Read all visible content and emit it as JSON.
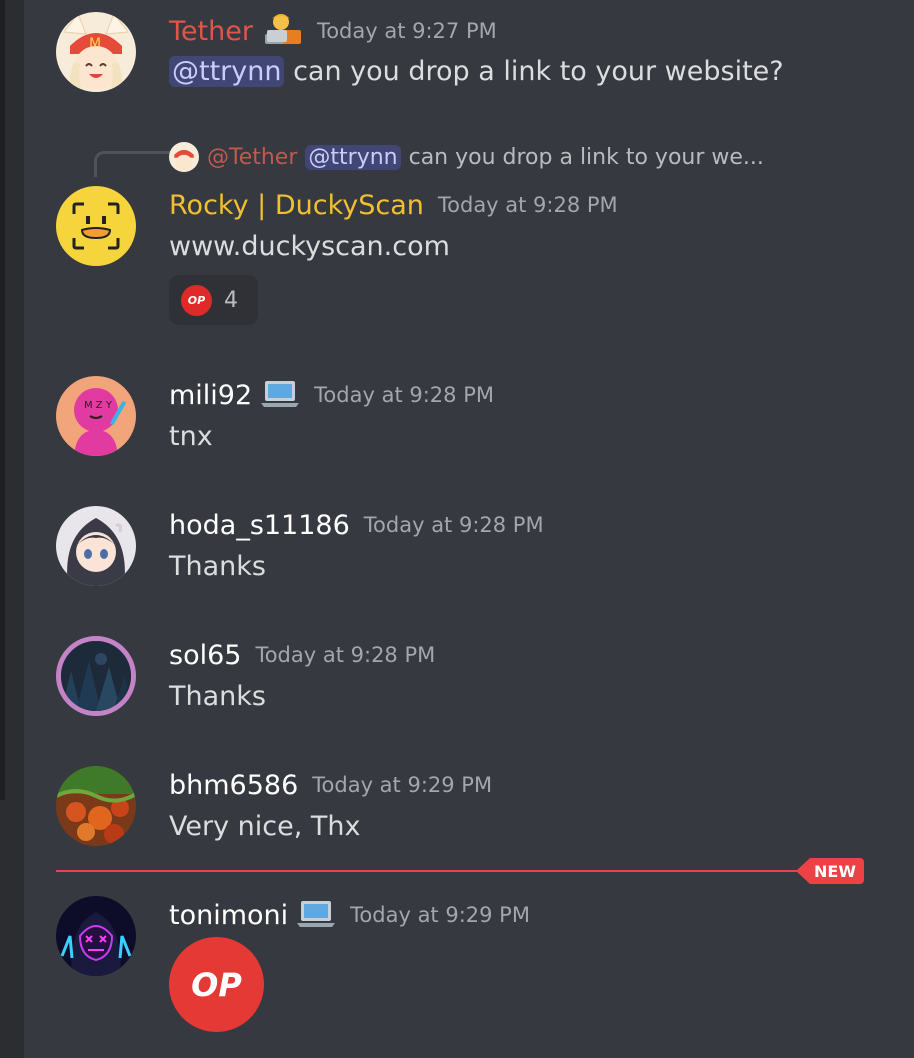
{
  "colors": {
    "background": "#36393f",
    "mention_bg": "#414675",
    "mention_text": "#c9cdfb",
    "tether_name": "#e0554a",
    "rocky_name": "#f0c030",
    "new_divider": "#ed4245"
  },
  "messages": [
    {
      "username": "Tether",
      "badge_icon": "technologist-emoji",
      "timestamp": "Today at 9:27 PM",
      "mention": "@ttrynn",
      "text": "can you drop a link to your website?"
    },
    {
      "reply": {
        "username": "@Tether",
        "mention": "@ttrynn",
        "text": "can you drop a link to your we..."
      },
      "username": "Rocky | DuckyScan",
      "timestamp": "Today at 9:28 PM",
      "text": "www.duckyscan.com",
      "reaction": {
        "emoji_label": "OP",
        "count": "4"
      }
    },
    {
      "username": "mili92",
      "badge_icon": "laptop-emoji",
      "timestamp": "Today at 9:28 PM",
      "text": "tnx"
    },
    {
      "username": "hoda_s11186",
      "timestamp": "Today at 9:28 PM",
      "text": "Thanks"
    },
    {
      "username": "sol65",
      "timestamp": "Today at 9:28 PM",
      "text": "Thanks"
    },
    {
      "username": "bhm6586",
      "timestamp": "Today at 9:29 PM",
      "text": "Very nice, Thx"
    },
    {
      "username": "tonimoni",
      "badge_icon": "laptop-emoji",
      "timestamp": "Today at 9:29 PM",
      "big_emoji_label": "OP"
    }
  ],
  "new_divider_label": "NEW"
}
